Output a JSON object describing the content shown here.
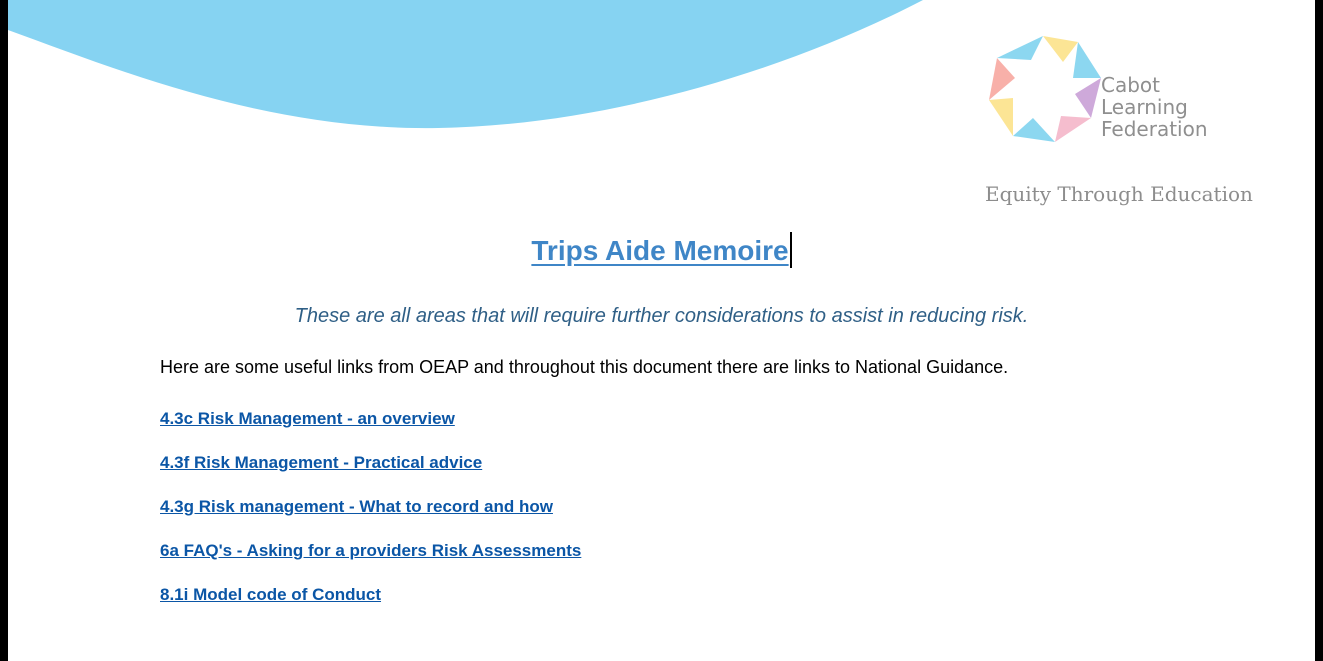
{
  "logo": {
    "line1": "Cabot",
    "line2": "Learning",
    "line3": "Federation",
    "tagline": "Equity Through Education",
    "colors": [
      "#f7a7a0",
      "#fce28a",
      "#7fd3ee",
      "#c9a0d6",
      "#f4b6c9"
    ]
  },
  "header_wave_color": "#86d3f2",
  "title": "Trips Aide Memoire",
  "subtitle": "These are all areas that will require further considerations to assist in reducing risk.",
  "intro": "Here are some useful links from OEAP and throughout this document there are links to National Guidance.",
  "links": [
    "4.3c Risk Management - an overview",
    "4.3f Risk Management - Practical advice",
    "4.3g Risk management - What to record and how",
    "6a FAQ's - Asking for a providers Risk Assessments",
    "8.1i Model code of Conduct"
  ]
}
